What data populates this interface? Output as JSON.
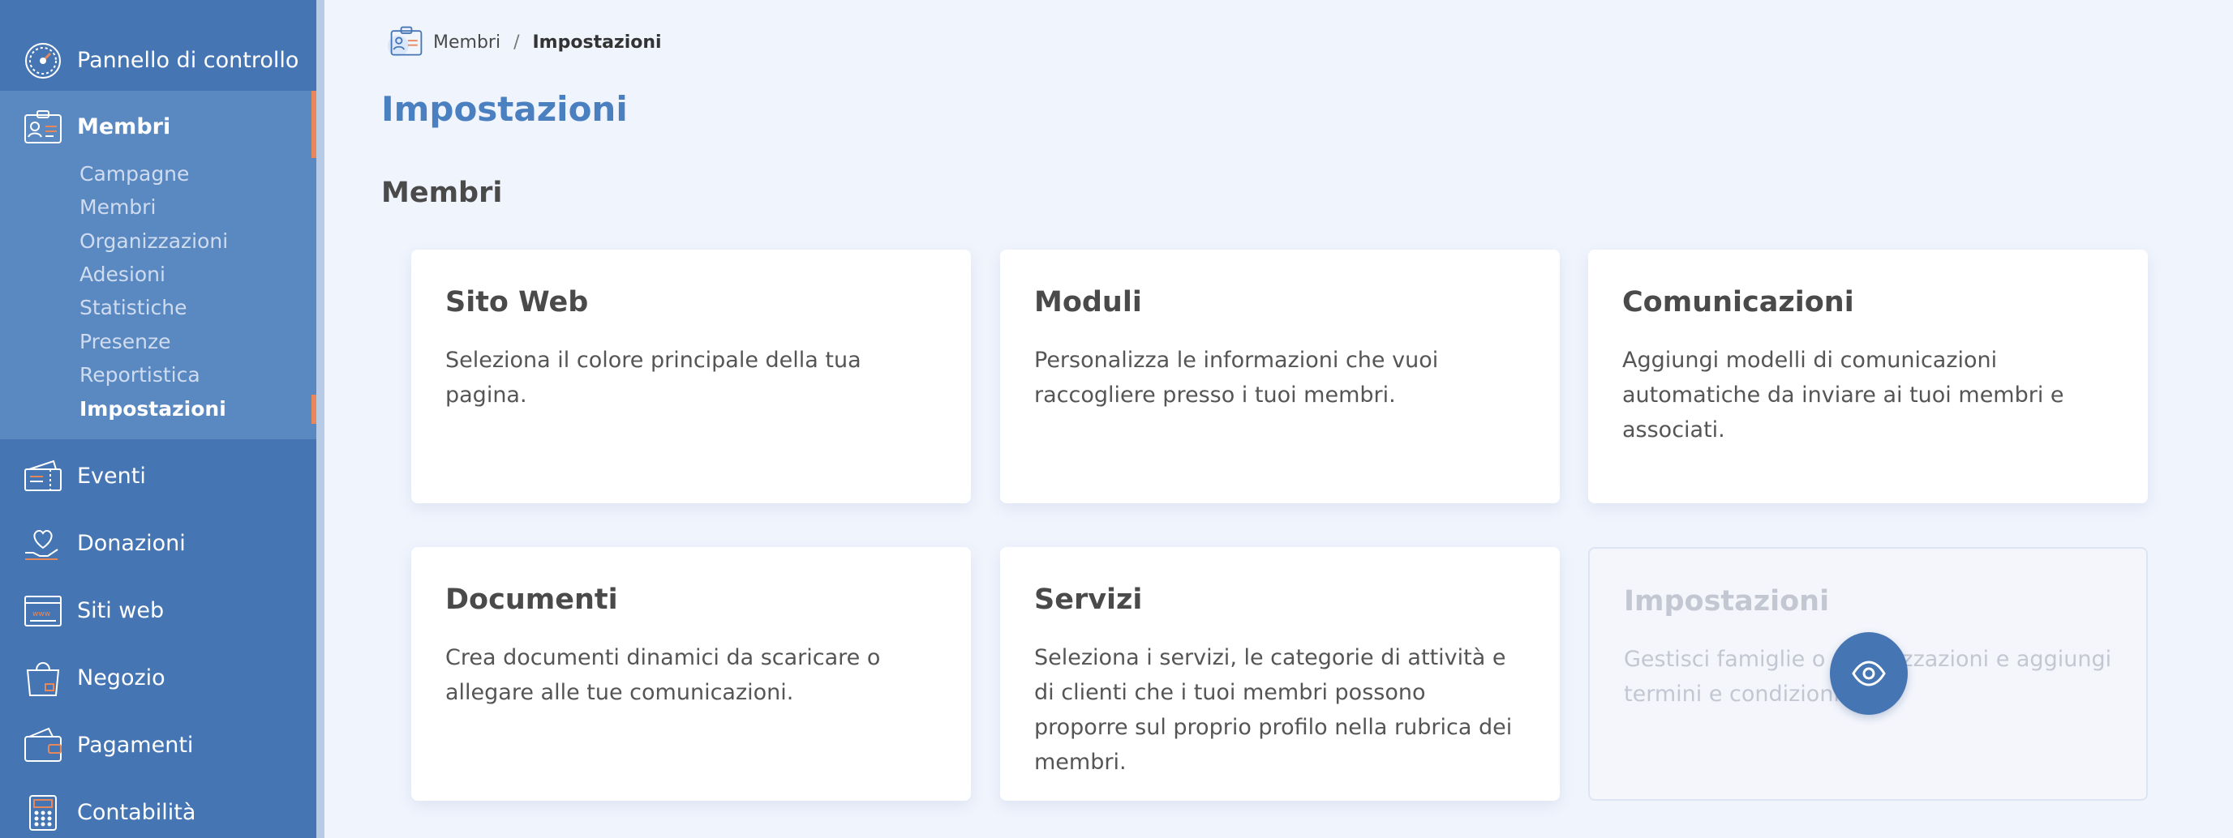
{
  "sidebar": {
    "items": [
      {
        "label": "Pannello di controllo",
        "icon": "gauge-icon"
      },
      {
        "label": "Membri",
        "icon": "member-card-icon"
      },
      {
        "label": "Eventi",
        "icon": "ticket-icon"
      },
      {
        "label": "Donazioni",
        "icon": "heart-hand-icon"
      },
      {
        "label": "Siti web",
        "icon": "browser-window-icon"
      },
      {
        "label": "Negozio",
        "icon": "shopping-bag-icon"
      },
      {
        "label": "Pagamenti",
        "icon": "wallet-icon"
      },
      {
        "label": "Contabilità",
        "icon": "calculator-icon"
      }
    ],
    "sub_items": [
      "Campagne",
      "Membri",
      "Organizzazioni",
      "Adesioni",
      "Statistiche",
      "Presenze",
      "Reportistica",
      "Impostazioni"
    ]
  },
  "breadcrumb": {
    "parent": "Membri",
    "separator": "/",
    "current": "Impostazioni"
  },
  "page": {
    "title": "Impostazioni",
    "section": "Membri"
  },
  "cards": [
    {
      "title": "Sito Web",
      "description": "Seleziona il colore principale della tua pagina."
    },
    {
      "title": "Moduli",
      "description": "Personalizza le informazioni che vuoi raccogliere presso i tuoi membri."
    },
    {
      "title": "Comunicazioni",
      "description": "Aggiungi modelli di comunicazioni automatiche da inviare ai tuoi membri e associati."
    },
    {
      "title": "Documenti",
      "description": "Crea documenti dinamici da scaricare o allegare alle tue comunicazioni."
    },
    {
      "title": "Servizi",
      "description": "Seleziona i servizi, le categorie di attività e di clienti che i tuoi membri possono proporre sul proprio profilo nella rubrica dei membri."
    },
    {
      "title": "Impostazioni",
      "description": "Gestisci famiglie o organizzazioni e aggiungi termini e condizioni."
    }
  ],
  "colors": {
    "sidebar": "#4576b3",
    "accent": "#e8885a",
    "title": "#4a7fc0"
  }
}
